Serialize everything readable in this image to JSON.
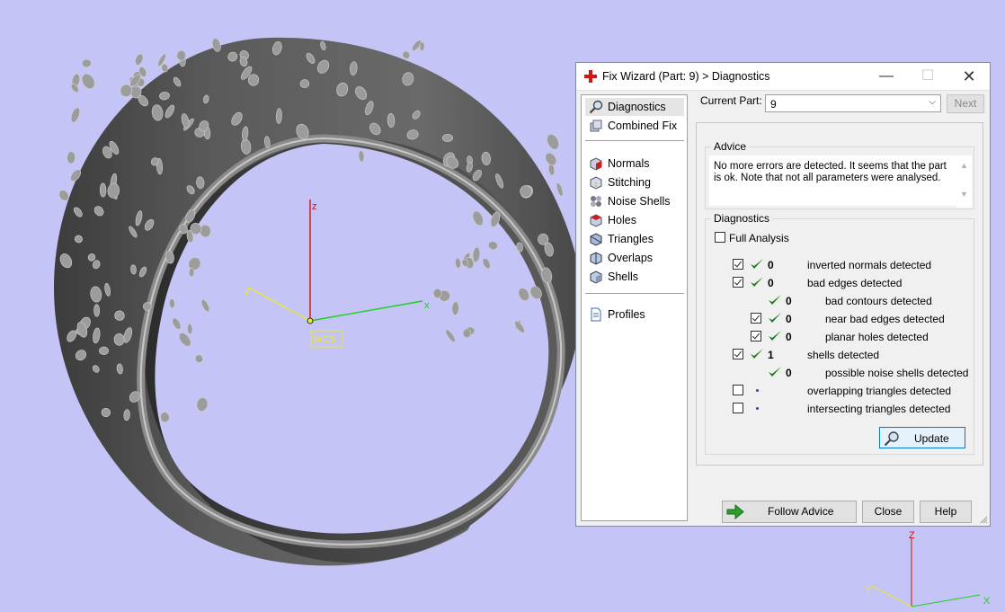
{
  "window": {
    "title": "Fix Wizard (Part: 9) > Diagnostics",
    "controls": {
      "minimize": "—",
      "maximize": "☐",
      "close": "✕"
    }
  },
  "nav": {
    "items": [
      {
        "label": "Diagnostics",
        "icon": "magnifier-icon"
      },
      {
        "label": "Combined Fix",
        "icon": "cube-stack-icon"
      },
      {
        "label": "Normals",
        "icon": "normals-cube-icon"
      },
      {
        "label": "Stitching",
        "icon": "stitching-cube-icon"
      },
      {
        "label": "Noise Shells",
        "icon": "noise-shells-icon"
      },
      {
        "label": "Holes",
        "icon": "holes-cube-icon"
      },
      {
        "label": "Triangles",
        "icon": "triangles-cube-icon"
      },
      {
        "label": "Overlaps",
        "icon": "overlaps-cube-icon"
      },
      {
        "label": "Shells",
        "icon": "shells-cube-icon"
      },
      {
        "label": "Profiles",
        "icon": "document-icon"
      }
    ]
  },
  "current_part": {
    "label": "Current Part:",
    "value": "9",
    "next_label": "Next"
  },
  "advice": {
    "title": "Advice",
    "text": "No more errors are detected. It seems that the part is ok. Note that not all parameters were analysed."
  },
  "diagnostics": {
    "title": "Diagnostics",
    "full_analysis_label": "Full Analysis",
    "rows": [
      {
        "checked": true,
        "status": "ok",
        "value": "0",
        "label": "inverted normals detected"
      },
      {
        "checked": true,
        "status": "ok",
        "value": "0",
        "label": "bad edges detected"
      },
      {
        "checked": null,
        "status": "ok",
        "value": "0",
        "label": "bad contours detected"
      },
      {
        "checked": true,
        "status": "ok",
        "value": "0",
        "label": "near bad edges detected"
      },
      {
        "checked": true,
        "status": "ok",
        "value": "0",
        "label": "planar holes detected"
      },
      {
        "checked": true,
        "status": "ok",
        "value": "1",
        "label": "shells detected"
      },
      {
        "checked": null,
        "status": "ok",
        "value": "0",
        "label": "possible noise shells detected"
      },
      {
        "checked": false,
        "status": "pending",
        "value": "",
        "label": "overlapping triangles detected"
      },
      {
        "checked": false,
        "status": "pending",
        "value": "",
        "label": "intersecting triangles detected"
      }
    ],
    "update_label": "Update"
  },
  "footer": {
    "follow_label": "Follow Advice",
    "close_label": "Close",
    "help_label": "Help"
  },
  "viewport": {
    "axis_labels": {
      "z": "z",
      "y": "y",
      "x": "x",
      "wcs": "WCS"
    },
    "corner_axis_labels": {
      "z": "Z",
      "y": "Y",
      "x": "X"
    }
  },
  "colors": {
    "background": "#c4c4f6",
    "check": "#1a7a1a",
    "z_axis": "#d01010",
    "x_axis": "#20d020",
    "y_axis": "#e8e830"
  }
}
